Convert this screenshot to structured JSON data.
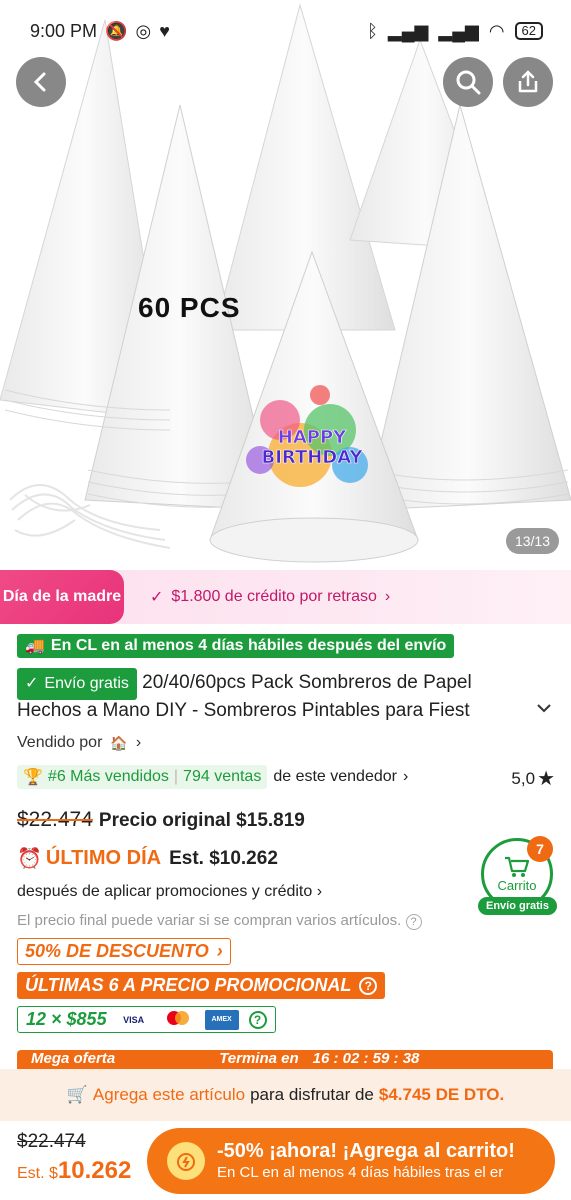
{
  "status": {
    "time": "9:00 PM",
    "battery": "62"
  },
  "hero": {
    "pcs_label": "60 PCS",
    "page_indicator": "13/13"
  },
  "promo": {
    "badge": "Día de la madre",
    "credit": "$1.800 de crédito por retraso"
  },
  "delivery_tag": "En CL en al menos 4 días hábiles después del envío",
  "free_shipping_tag": "Envío gratis",
  "title_line1": "20/40/60pcs Pack Sombreros de Papel",
  "title_line2": "Hechos a Mano DIY - Sombreros Pintables para Fiest",
  "sold_by": "Vendido por",
  "bestseller": {
    "rank": "#6 Más vendidos",
    "sales": "794 ventas",
    "suffix": "de este vendedor"
  },
  "rating": "5,0",
  "prices": {
    "old": "$22.474",
    "original_label": "Precio original $15.819",
    "last_day": "ÚLTIMO DÍA",
    "est": "Est. $10.262",
    "after_promo": "después de aplicar promociones y crédito",
    "note": "El precio final puede variar si se compran varios artículos."
  },
  "tags": {
    "discount": "50% DE DESCUENTO",
    "last_units": "ÚLTIMAS 6 A PRECIO PROMOCIONAL",
    "installments": "12 × $855"
  },
  "cart": {
    "label": "Carrito",
    "count": "7",
    "free_ship": "Envío gratis"
  },
  "mega": {
    "label": "Mega oferta",
    "ends": "Termina en",
    "timer": "16 : 02 : 59 : 38"
  },
  "add_bar": {
    "part1": "Agrega este artículo",
    "part2": "para disfrutar de",
    "amount": "$4.745 DE DTO."
  },
  "bottom": {
    "old": "$22.474",
    "est_prefix": "Est. $",
    "est_value": "10.262",
    "cta_title": "-50% ¡ahora! ¡Agrega al carrito!",
    "cta_sub": "En CL en al menos 4 días hábiles tras el er"
  },
  "colors": {
    "accent": "#f06a14",
    "green": "#1c9c3c",
    "pink": "#e8337a"
  }
}
